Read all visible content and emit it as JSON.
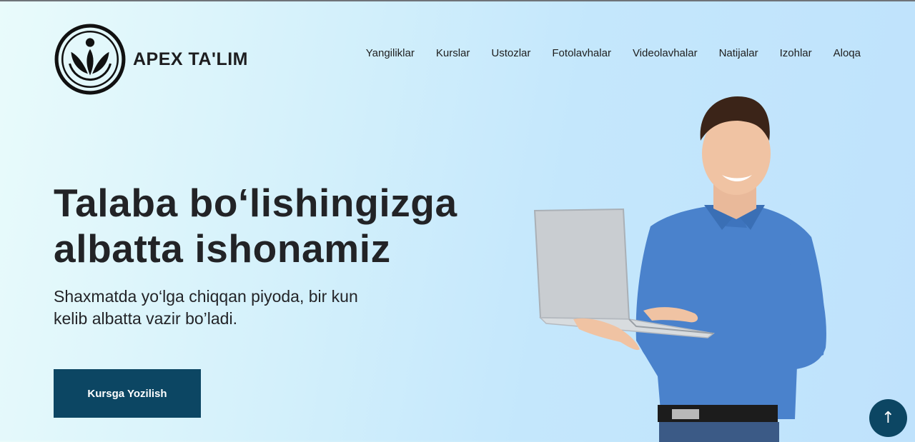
{
  "brand": {
    "name": "APEX TA'LIM",
    "logo_icon": "lotus-figure-logo-icon"
  },
  "nav": {
    "items": [
      "Yangiliklar",
      "Kurslar",
      "Ustozlar",
      "Fotolavhalar",
      "Videolavhalar",
      "Natijalar",
      "Izohlar",
      "Aloqa"
    ]
  },
  "hero": {
    "title_line1": "Talaba bo‘lishingizga",
    "title_line2": "albatta ishonamiz",
    "subtitle": "Shaxmatda yo‘lga chiqqan piyoda, bir kun kelib albatta vazir bo’ladi.",
    "cta_label": "Kursga Yozilish",
    "image_icon": "man-with-laptop-illustration"
  },
  "scroll_top": {
    "icon": "arrow-up-icon",
    "glyph": "↑"
  },
  "colors": {
    "accent": "#0c4663",
    "text": "#222326"
  }
}
